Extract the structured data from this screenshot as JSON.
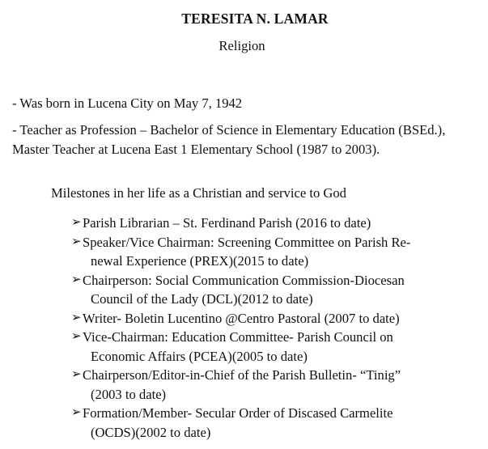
{
  "header": {
    "name": "TERESITA N. LAMAR",
    "subtitle": "Religion"
  },
  "paragraphs": [
    "- Was born in Lucena City on May 7, 1942",
    "- Teacher as Profession – Bachelor of Science  in Elementary Education (BSEd.), Master Teacher at Lucena East 1 Elementary School (1987 to 2003)."
  ],
  "milestones": {
    "heading": "Milestones in her life as a Christian and service to God",
    "bullet_icon": "arrowhead-bullet-icon",
    "items": [
      {
        "line1": "Parish Librarian – St. Ferdinand Parish (2016 to date)",
        "line2": ""
      },
      {
        "line1": "Speaker/Vice Chairman: Screening Committee on Parish Re-",
        "line2": "newal Experience (PREX)(2015 to date)"
      },
      {
        "line1": "Chairperson: Social Communication Commission-Diocesan",
        "line2": "Council of the Lady (DCL)(2012 to date)"
      },
      {
        "line1": "Writer- Boletin Lucentino @Centro Pastoral (2007 to date)",
        "line2": ""
      },
      {
        "line1": "Vice-Chairman: Education Committee- Parish Council on",
        "line2": "Economic Affairs (PCEA)(2005 to date)"
      },
      {
        "line1": "Chairperson/Editor-in-Chief of the Parish Bulletin- “Tinig”",
        "line2": "(2003 to date)"
      },
      {
        "line1": "Formation/Member- Secular Order of Discased Carmelite",
        "line2": "(OCDS)(2002 to date)"
      }
    ]
  }
}
